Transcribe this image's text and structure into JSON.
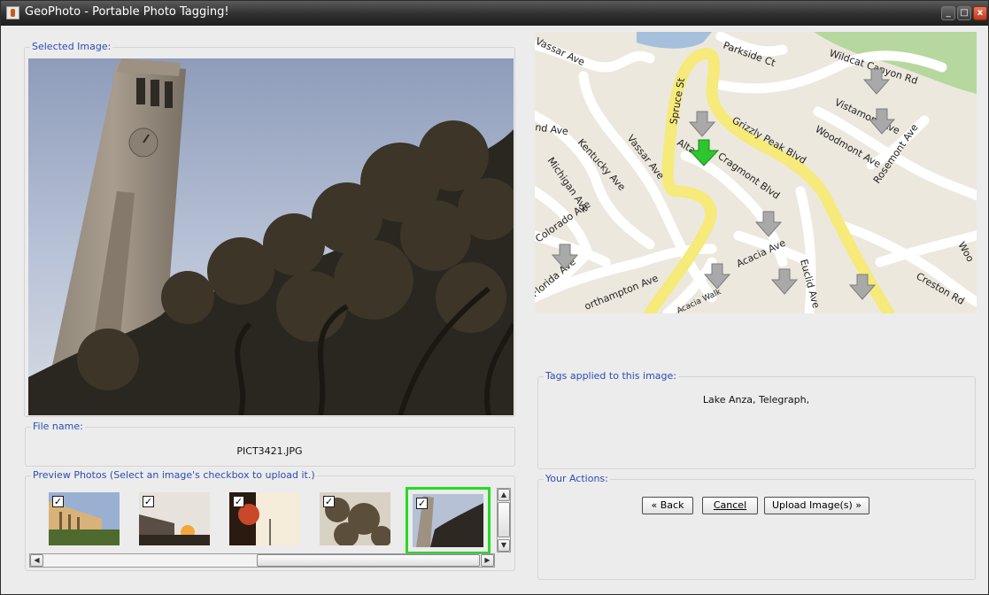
{
  "window": {
    "title": "GeoPhoto - Portable Photo Tagging!"
  },
  "selected_image": {
    "label": "Selected Image:"
  },
  "file_name": {
    "label": "File name:",
    "value": "PICT3421.JPG"
  },
  "preview": {
    "label": "Preview Photos (Select an image's checkbox to upload it.)",
    "thumbnails": [
      {
        "checked": true,
        "selected": false
      },
      {
        "checked": true,
        "selected": false
      },
      {
        "checked": true,
        "selected": false
      },
      {
        "checked": true,
        "selected": false
      },
      {
        "checked": true,
        "selected": true
      }
    ]
  },
  "map": {
    "streets": [
      "Vassar Ave",
      "Parkside Ct",
      "Wildcat Canyon Rd",
      "Spruce St",
      "Grizzly Peak Blvd",
      "Vistamont Ave",
      "nd Ave",
      "Kentucky Ave",
      "Vassar Ave",
      "Woodmont Ave",
      "Rosemont Ave",
      "Michigan Ave",
      "Alta",
      "Cragmont Blvd",
      "Colorado Ave",
      "Acacia Ave",
      "Euclid Ave",
      "Florida Ave",
      "orthampton Ave",
      "Acacia Walk",
      "Creston Rd",
      "Woo"
    ]
  },
  "tags": {
    "label": "Tags applied to this image:",
    "value": "Lake Anza, Telegraph,"
  },
  "actions": {
    "label": "Your Actions:",
    "back": "« Back",
    "cancel": "Cancel",
    "upload": "Upload Image(s) »"
  },
  "colors": {
    "group_label": "#2c4bb4",
    "selection_border": "#22dd22",
    "route": "#f5ea7a",
    "active_marker": "#2ec52e"
  }
}
